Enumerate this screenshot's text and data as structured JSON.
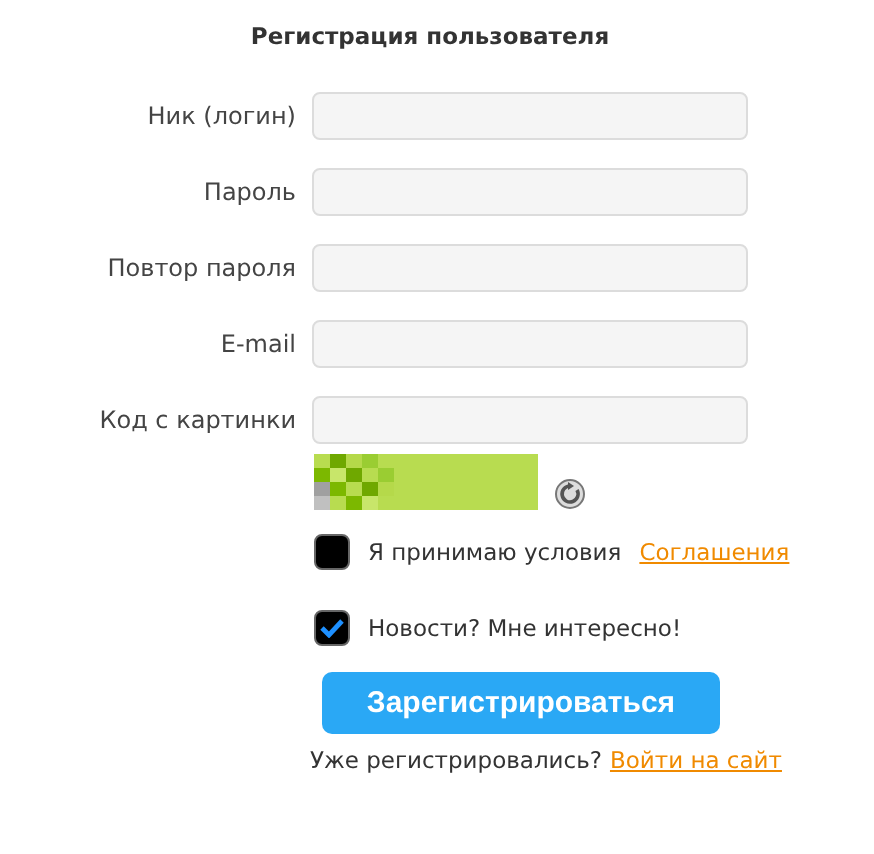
{
  "title": "Регистрация пользователя",
  "fields": [
    {
      "label": "Ник (логин)"
    },
    {
      "label": "Пароль"
    },
    {
      "label": "Повтор пароля"
    },
    {
      "label": "E-mail"
    },
    {
      "label": "Код с картинки"
    }
  ],
  "checkboxes": [
    {
      "text": "Я принимаю условия",
      "link": "Соглашения",
      "checked": false
    },
    {
      "text": "Новости? Мне интересно!",
      "checked": true
    }
  ],
  "submit": "Зарегистрироваться",
  "footer": {
    "text": "Уже регистрировались?",
    "link": "Войти на сайт"
  }
}
